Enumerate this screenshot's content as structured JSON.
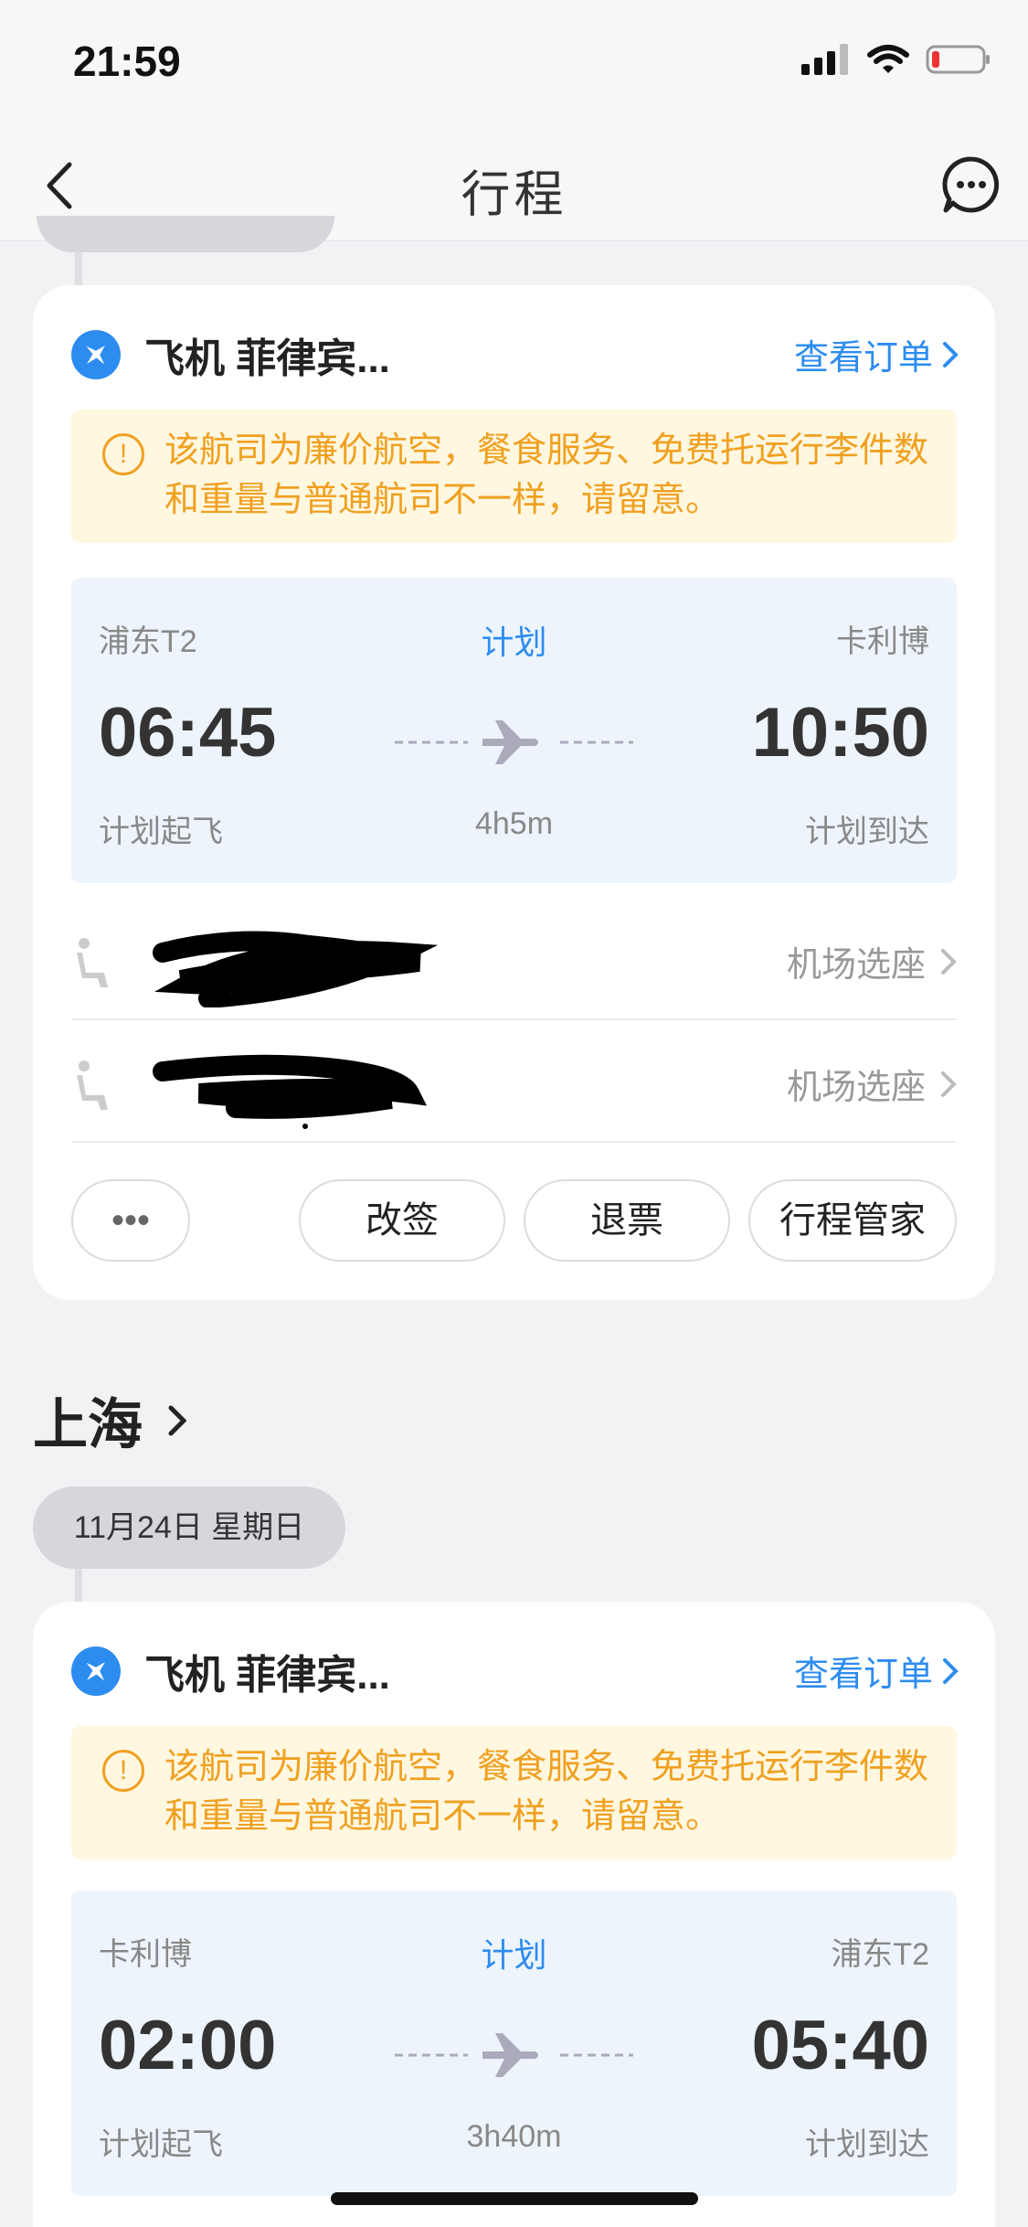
{
  "status_bar": {
    "time": "21:59"
  },
  "nav": {
    "title": "行程"
  },
  "cards": [
    {
      "title": "飞机 菲律宾...",
      "view_order": "查看订单",
      "notice": "该航司为廉价航空，餐食服务、免费托运行李件数和重量与普通航司不一样，请留意。",
      "flight": {
        "depart_airport": "浦东T2",
        "status": "计划",
        "arrive_airport": "卡利博",
        "depart_time": "06:45",
        "arrive_time": "10:50",
        "depart_label": "计划起飞",
        "duration": "4h5m",
        "arrive_label": "计划到达"
      },
      "passengers": [
        {
          "action": "机场选座"
        },
        {
          "action": "机场选座"
        }
      ],
      "buttons": {
        "more": "•••",
        "change": "改签",
        "refund": "退票",
        "assistant": "行程管家"
      }
    },
    {
      "title": "飞机 菲律宾...",
      "view_order": "查看订单",
      "notice": "该航司为廉价航空，餐食服务、免费托运行李件数和重量与普通航司不一样，请留意。",
      "flight": {
        "depart_airport": "卡利博",
        "status": "计划",
        "arrive_airport": "浦东T2",
        "depart_time": "02:00",
        "arrive_time": "05:40",
        "depart_label": "计划起飞",
        "duration": "3h40m",
        "arrive_label": "计划到达"
      }
    }
  ],
  "city_section": {
    "title": "上海",
    "date": "11月24日 星期日"
  },
  "colors": {
    "accent": "#2d8cf0",
    "warning": "#f0a020",
    "background": "#f2f2f5"
  }
}
